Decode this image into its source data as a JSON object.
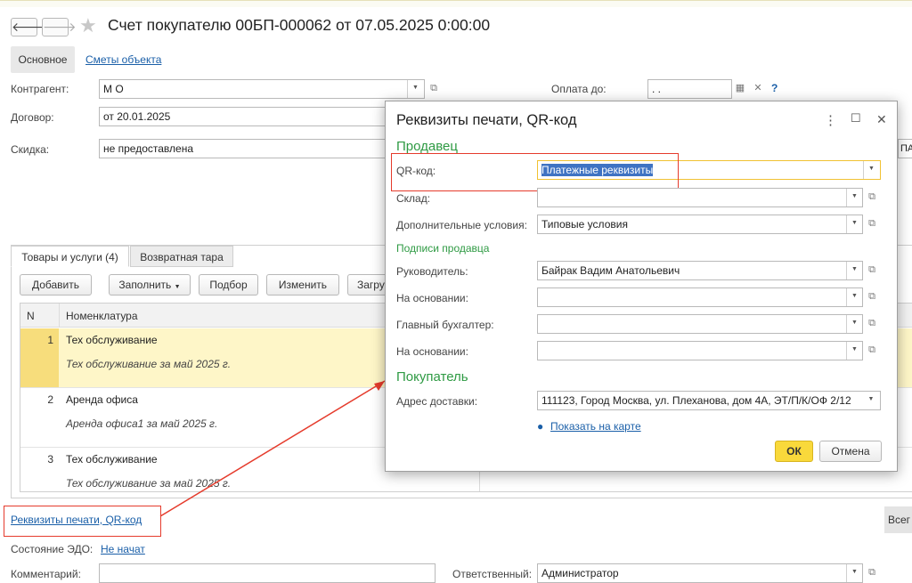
{
  "window": {
    "title": "Счет покупателю 00БП-000062 от 07.05.2025 0:00:00"
  },
  "nav": {
    "back": "🡐",
    "forward": "🡒",
    "star": "★"
  },
  "tabs_top": {
    "main": "Основное",
    "estimates": "Сметы объекта"
  },
  "form": {
    "counterparty_label": "Контрагент:",
    "counterparty_value": "М                                  О",
    "contract_label": "Договор:",
    "contract_value": "от 20.01.2025",
    "discount_label": "Скидка:",
    "discount_value": "не предоставлена",
    "pay_until_label": "Оплата до:",
    "pay_until_value": " .  .",
    "help": "?",
    "right_clip": "ПА"
  },
  "tabs": {
    "goods": "Товары и услуги (4)",
    "returnable": "Возвратная тара"
  },
  "toolbar": {
    "add": "Добавить",
    "fill": "Заполнить",
    "select": "Подбор",
    "edit": "Изменить",
    "load": "Загру"
  },
  "grid": {
    "col_n": "N",
    "col_nomenclature": "Номенклатура",
    "rows": [
      {
        "n": "1",
        "item": "Тех обслуживание",
        "desc": "Тех обслуживание за май 2025 г."
      },
      {
        "n": "2",
        "item": "Аренда офиса",
        "desc": "Аренда офиса1 за май 2025 г."
      },
      {
        "n": "3",
        "item": "Тех обслуживание",
        "desc": "Тех обслуживание за май 2025 г."
      }
    ]
  },
  "bottom": {
    "print_details_link": "Реквизиты печати, QR-код",
    "edo_label": "Состояние ЭДО:",
    "edo_value": "Не начат",
    "comment_label": "Комментарий:",
    "responsible_label": "Ответственный:",
    "responsible_value": "Администратор",
    "total_clip": "Всег"
  },
  "dialog": {
    "title": "Реквизиты печати, QR-код",
    "seller_section": "Продавец",
    "qr_label": "QR-код:",
    "qr_value": "Платежные реквизиты",
    "warehouse_label": "Склад:",
    "extra_terms_label": "Дополнительные условия:",
    "extra_terms_value": "Типовые условия",
    "signatures_section": "Подписи продавца",
    "director_label": "Руководитель:",
    "director_value": "Байрак Вадим  Анатольевич",
    "basis1_label": "На основании:",
    "accountant_label": "Главный бухгалтер:",
    "basis2_label": "На основании:",
    "buyer_section": "Покупатель",
    "delivery_label": "Адрес доставки:",
    "delivery_value": "111123, Город Москва, ул. Плеханова, дом 4А, ЭТ/П/К/ОФ 2/12",
    "show_on_map": "Показать на карте",
    "ok": "ОК",
    "cancel": "Отмена",
    "more": "⋮",
    "maximize": "☐",
    "close": "✕"
  },
  "colors": {
    "accent_green": "#2e9a43",
    "ok_yellow": "#f9d93b",
    "selection_yellow": "#fef6c8",
    "annotation_red": "#e53b2c",
    "link_blue": "#1a5fa8"
  }
}
